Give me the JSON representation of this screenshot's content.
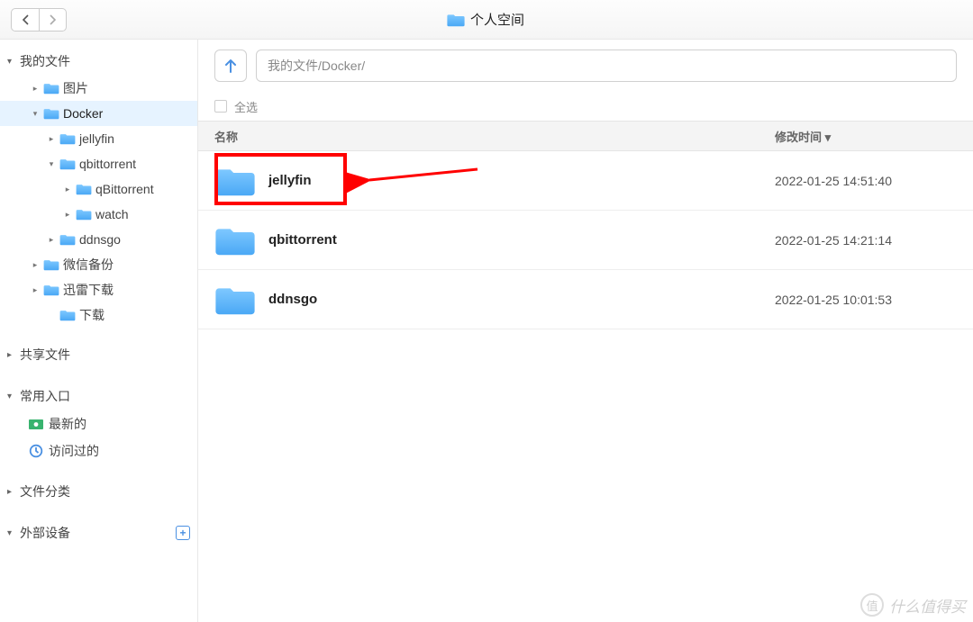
{
  "header": {
    "title": "个人空间"
  },
  "pathbar": {
    "path": "我的文件/Docker/"
  },
  "sidebar": {
    "myfiles": {
      "label": "我的文件",
      "items": [
        {
          "label": "图片",
          "depth": 1,
          "expandable": true,
          "expanded": false
        },
        {
          "label": "Docker",
          "depth": 1,
          "expandable": true,
          "expanded": true,
          "selected": true
        },
        {
          "label": "jellyfin",
          "depth": 2,
          "expandable": true,
          "expanded": false
        },
        {
          "label": "qbittorrent",
          "depth": 2,
          "expandable": true,
          "expanded": true
        },
        {
          "label": "qBittorrent",
          "depth": 3,
          "expandable": true,
          "expanded": false
        },
        {
          "label": "watch",
          "depth": 3,
          "expandable": true,
          "expanded": false
        },
        {
          "label": "ddnsgo",
          "depth": 2,
          "expandable": true,
          "expanded": false
        },
        {
          "label": "微信备份",
          "depth": 1,
          "expandable": true,
          "expanded": false
        },
        {
          "label": "迅雷下载",
          "depth": 1,
          "expandable": true,
          "expanded": false
        },
        {
          "label": "下载",
          "depth": 2,
          "expandable": false,
          "expanded": false
        }
      ]
    },
    "shared": {
      "label": "共享文件"
    },
    "quick": {
      "label": "常用入口",
      "recent": "最新的",
      "visited": "访问过的"
    },
    "category": {
      "label": "文件分类"
    },
    "external": {
      "label": "外部设备"
    }
  },
  "list": {
    "select_all": "全选",
    "col_name": "名称",
    "col_time": "修改时间",
    "rows": [
      {
        "name": "jellyfin",
        "time": "2022-01-25 14:51:40"
      },
      {
        "name": "qbittorrent",
        "time": "2022-01-25 14:21:14"
      },
      {
        "name": "ddnsgo",
        "time": "2022-01-25 10:01:53"
      }
    ]
  },
  "watermark": "什么值得买"
}
